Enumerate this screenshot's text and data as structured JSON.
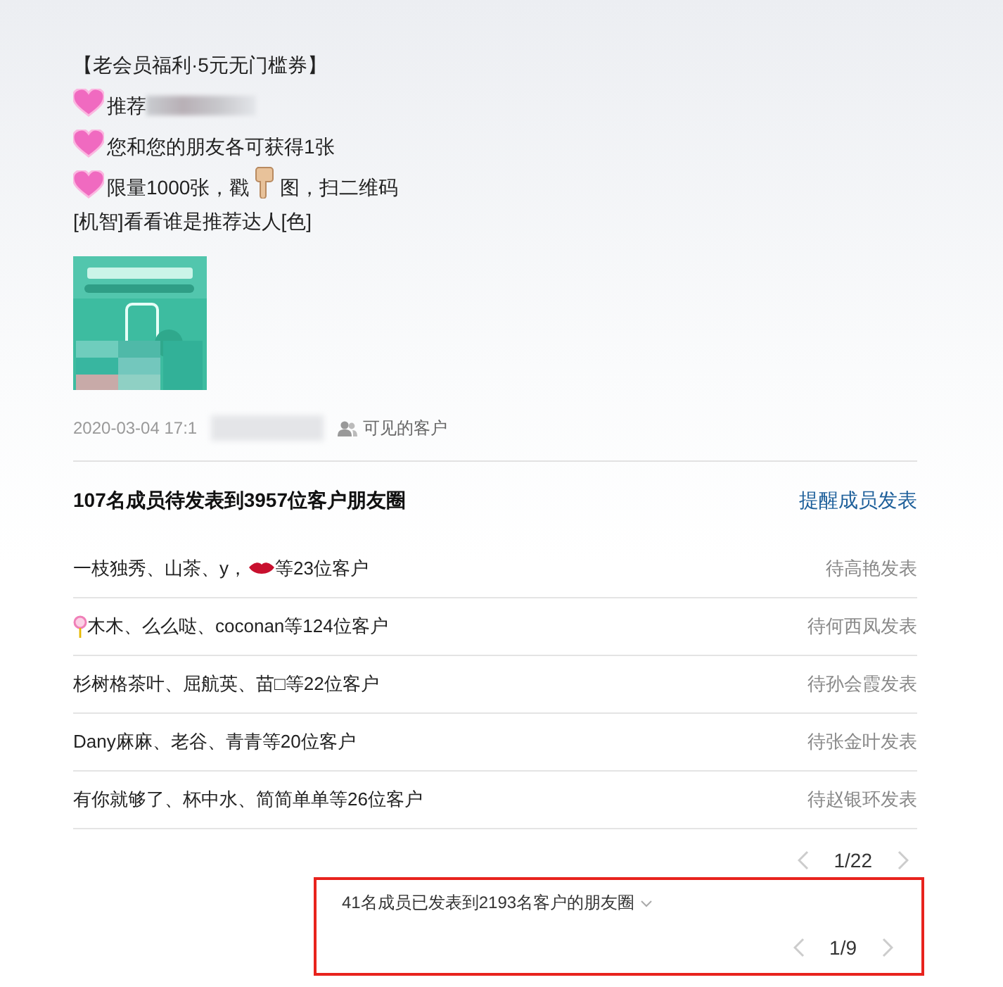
{
  "post": {
    "title": "【老会员福利·5元无门槛券】",
    "lines": [
      {
        "kind": "heart",
        "parts": [
          {
            "kind": "text",
            "text": "推荐"
          },
          {
            "kind": "blur"
          }
        ]
      },
      {
        "kind": "heart",
        "parts": [
          {
            "kind": "text",
            "text": "您和您的朋友各可获得1张"
          }
        ]
      },
      {
        "kind": "heart",
        "parts": [
          {
            "kind": "text",
            "text": "限量1000张，戳"
          },
          {
            "kind": "finger"
          },
          {
            "kind": "text",
            "text": "图，扫二维码"
          }
        ]
      },
      {
        "kind": "plain",
        "parts": [
          {
            "kind": "text",
            "text": "[机智]看看谁是推荐达人[色]"
          }
        ]
      }
    ],
    "time": "2020-03-04 17:1",
    "visibility": "可见的客户"
  },
  "pending": {
    "title": "107名成员待发表到3957位客户朋友圈",
    "action": "提醒成员发表",
    "rows": [
      {
        "parts": [
          {
            "kind": "text",
            "text": "一枝独秀、山茶、y，"
          },
          {
            "kind": "lips"
          },
          {
            "kind": "text",
            "text": "等23位客户"
          }
        ],
        "status": "待高艳发表"
      },
      {
        "parts": [
          {
            "kind": "lollipop"
          },
          {
            "kind": "text",
            "text": "木木、么么哒、coconan等124位客户"
          }
        ],
        "status": "待何西凤发表"
      },
      {
        "parts": [
          {
            "kind": "text",
            "text": "杉树格茶叶、屈航英、苗□等22位客户"
          }
        ],
        "status": "待孙会霞发表"
      },
      {
        "parts": [
          {
            "kind": "text",
            "text": "Dany麻麻、老谷、青青等20位客户"
          }
        ],
        "status": "待张金叶发表"
      },
      {
        "parts": [
          {
            "kind": "text",
            "text": "有你就够了、杯中水、简简单单等26位客户"
          }
        ],
        "status": "待赵银环发表"
      }
    ],
    "pager": "1/22"
  },
  "published": {
    "title": "41名成员已发表到2193名客户的朋友圈",
    "pager": "1/9",
    "highlighted": true
  }
}
